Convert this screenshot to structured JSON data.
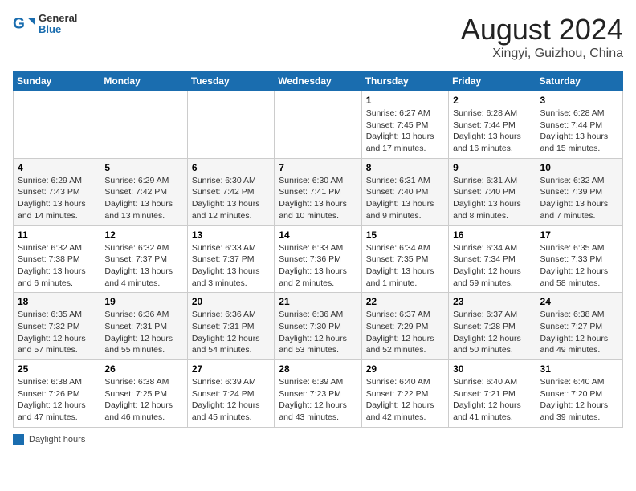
{
  "header": {
    "logo_line1": "General",
    "logo_line2": "Blue",
    "title": "August 2024",
    "subtitle": "Xingyi, Guizhou, China"
  },
  "days_of_week": [
    "Sunday",
    "Monday",
    "Tuesday",
    "Wednesday",
    "Thursday",
    "Friday",
    "Saturday"
  ],
  "weeks": [
    [
      {
        "day": "",
        "info": ""
      },
      {
        "day": "",
        "info": ""
      },
      {
        "day": "",
        "info": ""
      },
      {
        "day": "",
        "info": ""
      },
      {
        "day": "1",
        "info": "Sunrise: 6:27 AM\nSunset: 7:45 PM\nDaylight: 13 hours and 17 minutes."
      },
      {
        "day": "2",
        "info": "Sunrise: 6:28 AM\nSunset: 7:44 PM\nDaylight: 13 hours and 16 minutes."
      },
      {
        "day": "3",
        "info": "Sunrise: 6:28 AM\nSunset: 7:44 PM\nDaylight: 13 hours and 15 minutes."
      }
    ],
    [
      {
        "day": "4",
        "info": "Sunrise: 6:29 AM\nSunset: 7:43 PM\nDaylight: 13 hours and 14 minutes."
      },
      {
        "day": "5",
        "info": "Sunrise: 6:29 AM\nSunset: 7:42 PM\nDaylight: 13 hours and 13 minutes."
      },
      {
        "day": "6",
        "info": "Sunrise: 6:30 AM\nSunset: 7:42 PM\nDaylight: 13 hours and 12 minutes."
      },
      {
        "day": "7",
        "info": "Sunrise: 6:30 AM\nSunset: 7:41 PM\nDaylight: 13 hours and 10 minutes."
      },
      {
        "day": "8",
        "info": "Sunrise: 6:31 AM\nSunset: 7:40 PM\nDaylight: 13 hours and 9 minutes."
      },
      {
        "day": "9",
        "info": "Sunrise: 6:31 AM\nSunset: 7:40 PM\nDaylight: 13 hours and 8 minutes."
      },
      {
        "day": "10",
        "info": "Sunrise: 6:32 AM\nSunset: 7:39 PM\nDaylight: 13 hours and 7 minutes."
      }
    ],
    [
      {
        "day": "11",
        "info": "Sunrise: 6:32 AM\nSunset: 7:38 PM\nDaylight: 13 hours and 6 minutes."
      },
      {
        "day": "12",
        "info": "Sunrise: 6:32 AM\nSunset: 7:37 PM\nDaylight: 13 hours and 4 minutes."
      },
      {
        "day": "13",
        "info": "Sunrise: 6:33 AM\nSunset: 7:37 PM\nDaylight: 13 hours and 3 minutes."
      },
      {
        "day": "14",
        "info": "Sunrise: 6:33 AM\nSunset: 7:36 PM\nDaylight: 13 hours and 2 minutes."
      },
      {
        "day": "15",
        "info": "Sunrise: 6:34 AM\nSunset: 7:35 PM\nDaylight: 13 hours and 1 minute."
      },
      {
        "day": "16",
        "info": "Sunrise: 6:34 AM\nSunset: 7:34 PM\nDaylight: 12 hours and 59 minutes."
      },
      {
        "day": "17",
        "info": "Sunrise: 6:35 AM\nSunset: 7:33 PM\nDaylight: 12 hours and 58 minutes."
      }
    ],
    [
      {
        "day": "18",
        "info": "Sunrise: 6:35 AM\nSunset: 7:32 PM\nDaylight: 12 hours and 57 minutes."
      },
      {
        "day": "19",
        "info": "Sunrise: 6:36 AM\nSunset: 7:31 PM\nDaylight: 12 hours and 55 minutes."
      },
      {
        "day": "20",
        "info": "Sunrise: 6:36 AM\nSunset: 7:31 PM\nDaylight: 12 hours and 54 minutes."
      },
      {
        "day": "21",
        "info": "Sunrise: 6:36 AM\nSunset: 7:30 PM\nDaylight: 12 hours and 53 minutes."
      },
      {
        "day": "22",
        "info": "Sunrise: 6:37 AM\nSunset: 7:29 PM\nDaylight: 12 hours and 52 minutes."
      },
      {
        "day": "23",
        "info": "Sunrise: 6:37 AM\nSunset: 7:28 PM\nDaylight: 12 hours and 50 minutes."
      },
      {
        "day": "24",
        "info": "Sunrise: 6:38 AM\nSunset: 7:27 PM\nDaylight: 12 hours and 49 minutes."
      }
    ],
    [
      {
        "day": "25",
        "info": "Sunrise: 6:38 AM\nSunset: 7:26 PM\nDaylight: 12 hours and 47 minutes."
      },
      {
        "day": "26",
        "info": "Sunrise: 6:38 AM\nSunset: 7:25 PM\nDaylight: 12 hours and 46 minutes."
      },
      {
        "day": "27",
        "info": "Sunrise: 6:39 AM\nSunset: 7:24 PM\nDaylight: 12 hours and 45 minutes."
      },
      {
        "day": "28",
        "info": "Sunrise: 6:39 AM\nSunset: 7:23 PM\nDaylight: 12 hours and 43 minutes."
      },
      {
        "day": "29",
        "info": "Sunrise: 6:40 AM\nSunset: 7:22 PM\nDaylight: 12 hours and 42 minutes."
      },
      {
        "day": "30",
        "info": "Sunrise: 6:40 AM\nSunset: 7:21 PM\nDaylight: 12 hours and 41 minutes."
      },
      {
        "day": "31",
        "info": "Sunrise: 6:40 AM\nSunset: 7:20 PM\nDaylight: 12 hours and 39 minutes."
      }
    ]
  ],
  "legend": {
    "label": "Daylight hours"
  }
}
